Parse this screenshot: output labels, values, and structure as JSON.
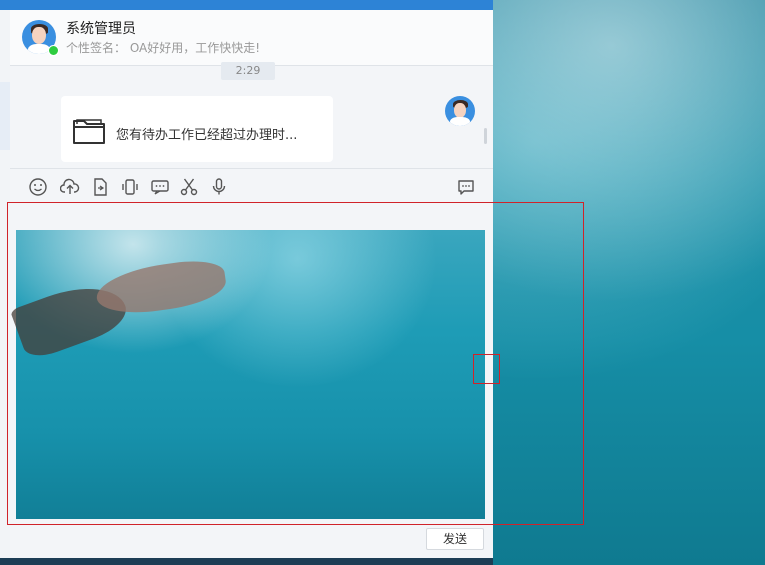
{
  "header": {
    "title": "系统管理员",
    "signature": "个性签名： OA好好用，工作快快走!"
  },
  "chat": {
    "time": "2:29",
    "message_text": "您有待办工作已经超过办理时..."
  },
  "toolbar": {
    "icons": [
      "emoji-icon",
      "upload-icon",
      "file-icon",
      "vibrate-icon",
      "message-icon",
      "scissors-icon",
      "mic-icon",
      "chat-history-icon"
    ]
  },
  "editor": {
    "send_label": "发送"
  },
  "colors": {
    "accent": "#2d83d6",
    "online": "#2ecc40",
    "selection": "#d0232a"
  }
}
